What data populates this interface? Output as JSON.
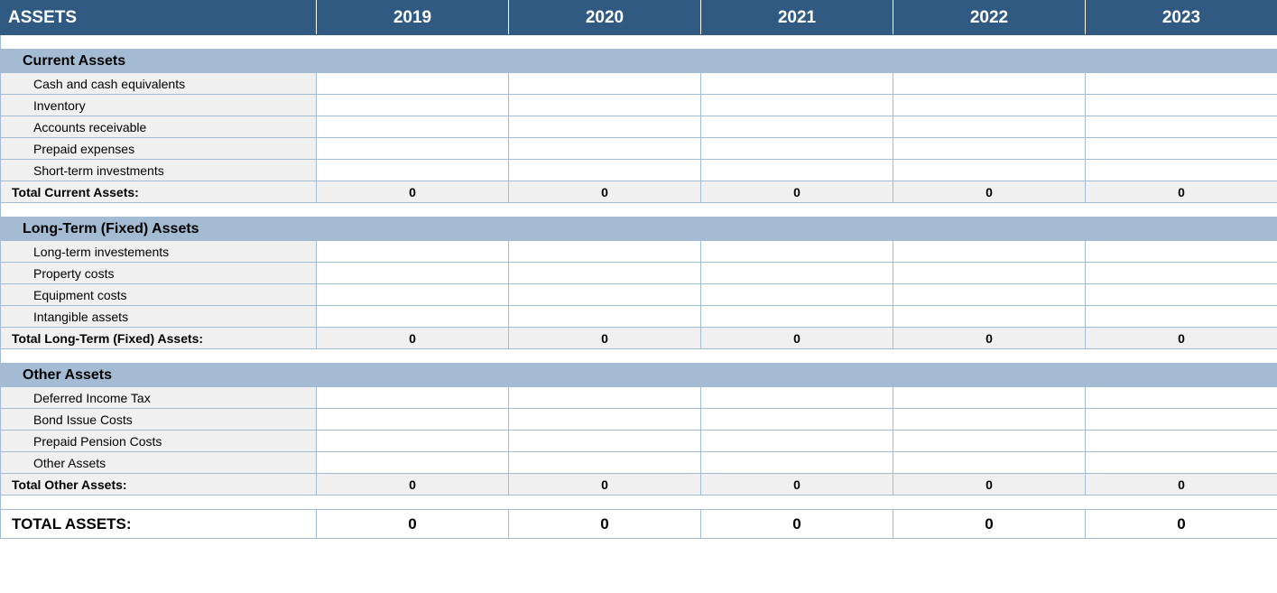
{
  "header": {
    "title": "ASSETS",
    "years": [
      "2019",
      "2020",
      "2021",
      "2022",
      "2023"
    ]
  },
  "sections": [
    {
      "title": "Current Assets",
      "items": [
        {
          "label": "Cash and cash equivalents",
          "values": [
            "",
            "",
            "",
            "",
            ""
          ]
        },
        {
          "label": "Inventory",
          "values": [
            "",
            "",
            "",
            "",
            ""
          ]
        },
        {
          "label": "Accounts receivable",
          "values": [
            "",
            "",
            "",
            "",
            ""
          ]
        },
        {
          "label": "Prepaid expenses",
          "values": [
            "",
            "",
            "",
            "",
            ""
          ]
        },
        {
          "label": "Short-term investments",
          "values": [
            "",
            "",
            "",
            "",
            ""
          ]
        }
      ],
      "total_label": "Total Current Assets:",
      "total_values": [
        "0",
        "0",
        "0",
        "0",
        "0"
      ]
    },
    {
      "title": "Long-Term (Fixed) Assets",
      "items": [
        {
          "label": "Long-term investements",
          "values": [
            "",
            "",
            "",
            "",
            ""
          ]
        },
        {
          "label": "Property costs",
          "values": [
            "",
            "",
            "",
            "",
            ""
          ]
        },
        {
          "label": "Equipment costs",
          "values": [
            "",
            "",
            "",
            "",
            ""
          ]
        },
        {
          "label": "Intangible assets",
          "values": [
            "",
            "",
            "",
            "",
            ""
          ]
        }
      ],
      "total_label": "Total Long-Term (Fixed) Assets:",
      "total_values": [
        "0",
        "0",
        "0",
        "0",
        "0"
      ]
    },
    {
      "title": "Other Assets",
      "items": [
        {
          "label": "Deferred Income Tax",
          "values": [
            "",
            "",
            "",
            "",
            ""
          ]
        },
        {
          "label": "Bond Issue Costs",
          "values": [
            "",
            "",
            "",
            "",
            ""
          ]
        },
        {
          "label": "Prepaid Pension Costs",
          "values": [
            "",
            "",
            "",
            "",
            ""
          ]
        },
        {
          "label": "Other Assets",
          "values": [
            "",
            "",
            "",
            "",
            ""
          ]
        }
      ],
      "total_label": "Total Other Assets:",
      "total_values": [
        "0",
        "0",
        "0",
        "0",
        "0"
      ]
    }
  ],
  "grand_total": {
    "label": "TOTAL ASSETS:",
    "values": [
      "0",
      "0",
      "0",
      "0",
      "0"
    ]
  }
}
